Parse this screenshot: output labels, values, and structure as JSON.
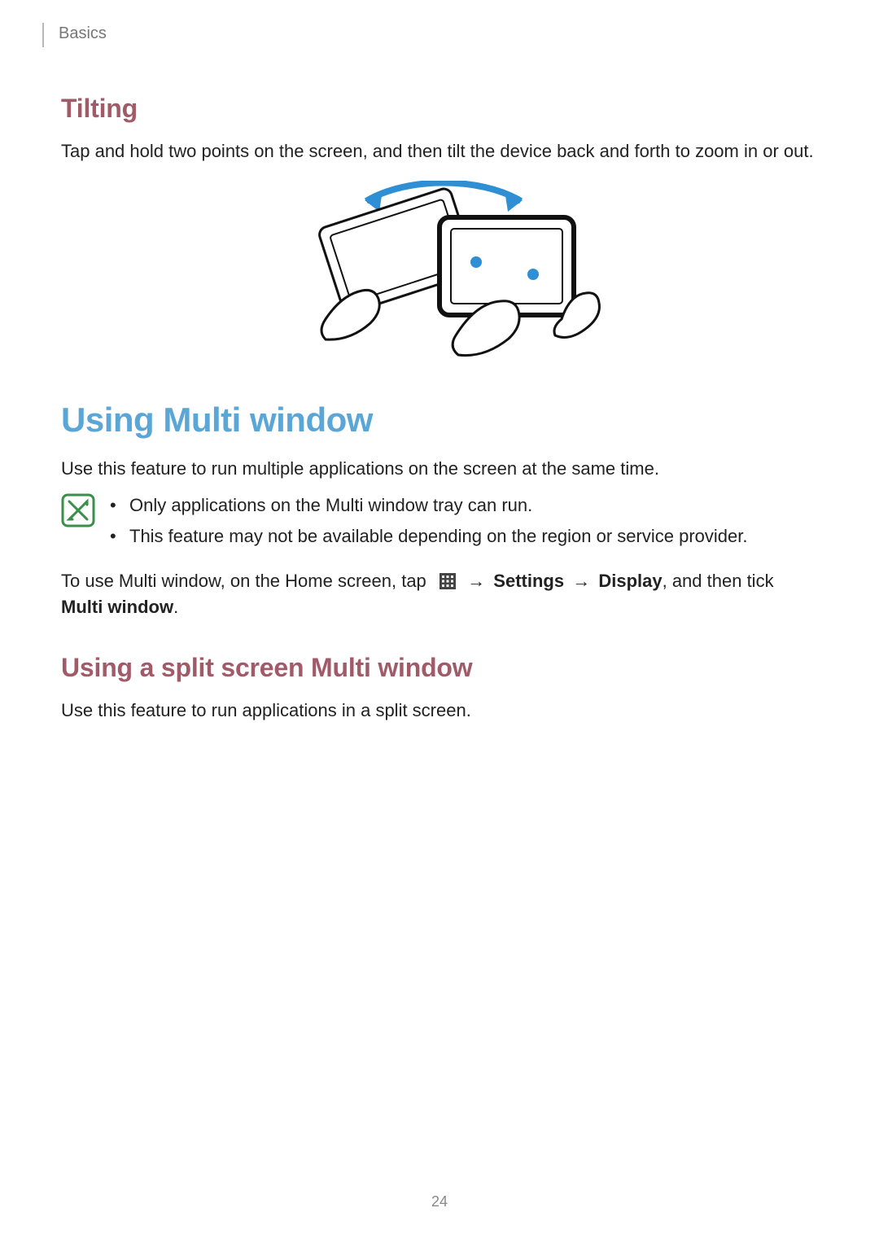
{
  "breadcrumb": "Basics",
  "section_tilting": {
    "heading": "Tilting",
    "body": "Tap and hold two points on the screen, and then tilt the device back and forth to zoom in or out."
  },
  "section_multi_window": {
    "heading": "Using Multi window",
    "intro": "Use this feature to run multiple applications on the screen at the same time.",
    "notes": [
      "Only applications on the Multi window tray can run.",
      "This feature may not be available depending on the region or service provider."
    ],
    "instruction_prefix": "To use Multi window, on the Home screen, tap ",
    "arrow": "→",
    "settings_label": "Settings",
    "display_label": "Display",
    "instruction_mid": ", and then tick ",
    "multi_window_label": "Multi window",
    "period": "."
  },
  "section_split": {
    "heading": "Using a split screen Multi window",
    "body": "Use this feature to run applications in a split screen."
  },
  "page_number": "24",
  "icons": {
    "note": "note-icon",
    "apps": "apps-grid-icon",
    "figure": "tilting-figure"
  }
}
